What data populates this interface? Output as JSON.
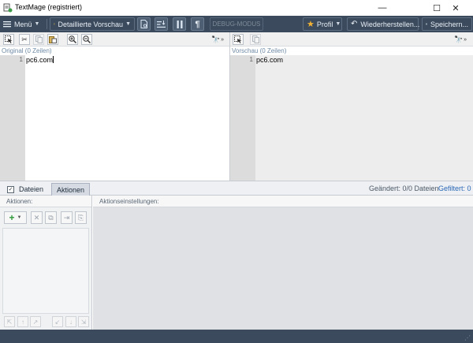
{
  "window": {
    "title": "TextMage (registriert)",
    "controls": {
      "minimize": "—",
      "maximize": "☐",
      "close": "✕"
    }
  },
  "toolbar": {
    "menu_label": "Menü",
    "preview_mode_label": "Detaillierte Vorschau",
    "debug_label": "DEBUG-MODUS",
    "profile_label": "Profil",
    "restore_label": "Wiederherstellen...",
    "save_label": "Speichern...",
    "icons": [
      "hamburger-icon",
      "preview-mode-icon",
      "document-icon",
      "sort-icon",
      "pause-icon",
      "pilcrow-icon",
      "star-icon",
      "undo-icon",
      "save-icon"
    ]
  },
  "original_pane": {
    "caption": "Original (0 Zeilen)",
    "lines": [
      {
        "number": "1",
        "text": "pc6.com"
      }
    ],
    "tools": [
      "select-all-icon",
      "cut-icon",
      "copy-icon",
      "paste-icon",
      "zoom-in-icon",
      "zoom-out-icon",
      "find-icon"
    ]
  },
  "preview_pane": {
    "caption": "Vorschau (0 Zeilen)",
    "lines": [
      {
        "number": "1",
        "text": "pc6.com"
      }
    ],
    "tools": [
      "select-all-icon",
      "copy-icon",
      "find-icon"
    ]
  },
  "tabs": {
    "files_label": "Dateien",
    "files_checked": true,
    "actions_label": "Aktionen",
    "active": "Aktionen"
  },
  "status": {
    "changed": "Geändert: 0/0 Dateien",
    "filtered": "Gefiltert: 0"
  },
  "actions_panel": {
    "header": "Aktionen:",
    "toolbar_icons": [
      "add-icon",
      "chevron-down-icon",
      "delete-icon",
      "clone-icon",
      "import-icon",
      "export-icon"
    ],
    "nav_icons": [
      "move-top-icon",
      "move-up-icon",
      "move-top-right-icon",
      "move-bottom-left-icon",
      "move-down-icon",
      "move-bottom-icon"
    ]
  },
  "settings_panel": {
    "header": "Aktionseinstellungen:"
  },
  "colors": {
    "toolbar_bg": "#3b4a5c",
    "accent_blue": "#2a67b6",
    "add_green": "#2f9a3a",
    "profile_star": "#f2b233"
  }
}
